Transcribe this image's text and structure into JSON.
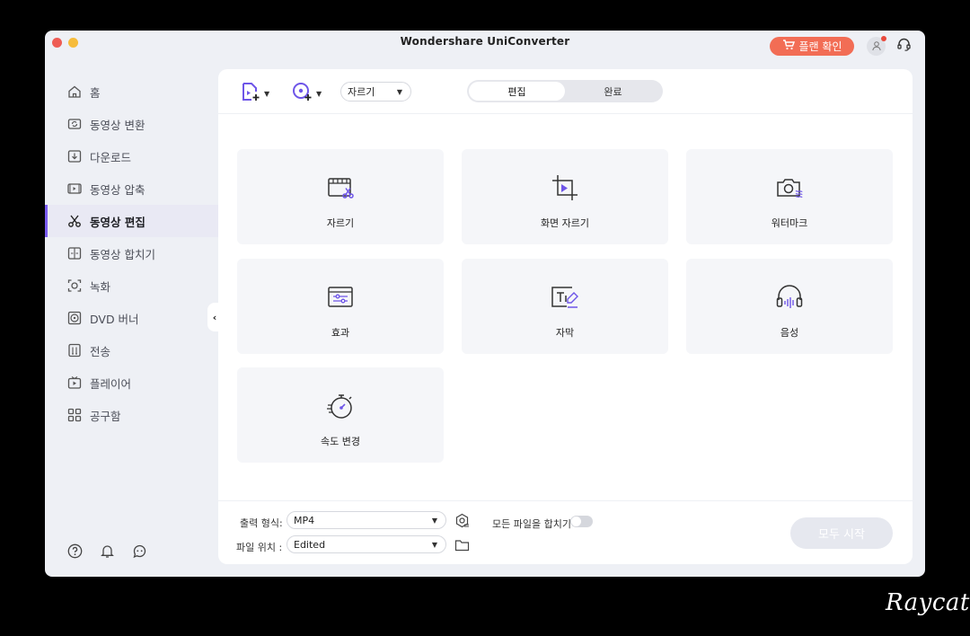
{
  "window": {
    "title": "Wondershare UniConverter"
  },
  "header": {
    "plan_label": "플랜 확인",
    "plan_color": "#f26d55"
  },
  "sidebar": {
    "items": [
      {
        "label": "홈",
        "icon": "home-icon"
      },
      {
        "label": "동영상 변환",
        "icon": "convert-icon"
      },
      {
        "label": "다운로드",
        "icon": "download-icon"
      },
      {
        "label": "동영상 압축",
        "icon": "compress-icon"
      },
      {
        "label": "동영상 편집",
        "icon": "scissors-icon",
        "active": true
      },
      {
        "label": "동영상 합치기",
        "icon": "merge-icon"
      },
      {
        "label": "녹화",
        "icon": "record-icon"
      },
      {
        "label": "DVD 버너",
        "icon": "disc-icon"
      },
      {
        "label": "전송",
        "icon": "transfer-icon"
      },
      {
        "label": "플레이어",
        "icon": "player-icon"
      },
      {
        "label": "공구함",
        "icon": "toolbox-icon"
      }
    ],
    "accent": "#7a5cf0"
  },
  "toolbar": {
    "mode_value": "자르기",
    "tabs": [
      {
        "label": "편집",
        "active": true
      },
      {
        "label": "완료"
      }
    ]
  },
  "tools": [
    {
      "label": "자르기",
      "icon": "trim-icon"
    },
    {
      "label": "화면 자르기",
      "icon": "crop-icon"
    },
    {
      "label": "워터마크",
      "icon": "watermark-icon"
    },
    {
      "label": "효과",
      "icon": "effect-icon"
    },
    {
      "label": "자막",
      "icon": "subtitle-icon"
    },
    {
      "label": "음성",
      "icon": "audio-icon"
    },
    {
      "label": "속도 변경",
      "icon": "speed-icon"
    }
  ],
  "footer": {
    "output_label": "출력 형식:",
    "output_value": "MP4",
    "location_label": "파일 위치 :",
    "location_value": "Edited",
    "merge_label": "모든 파일을 합치기",
    "start_label": "모두 시작"
  },
  "watermark": "Raycat"
}
